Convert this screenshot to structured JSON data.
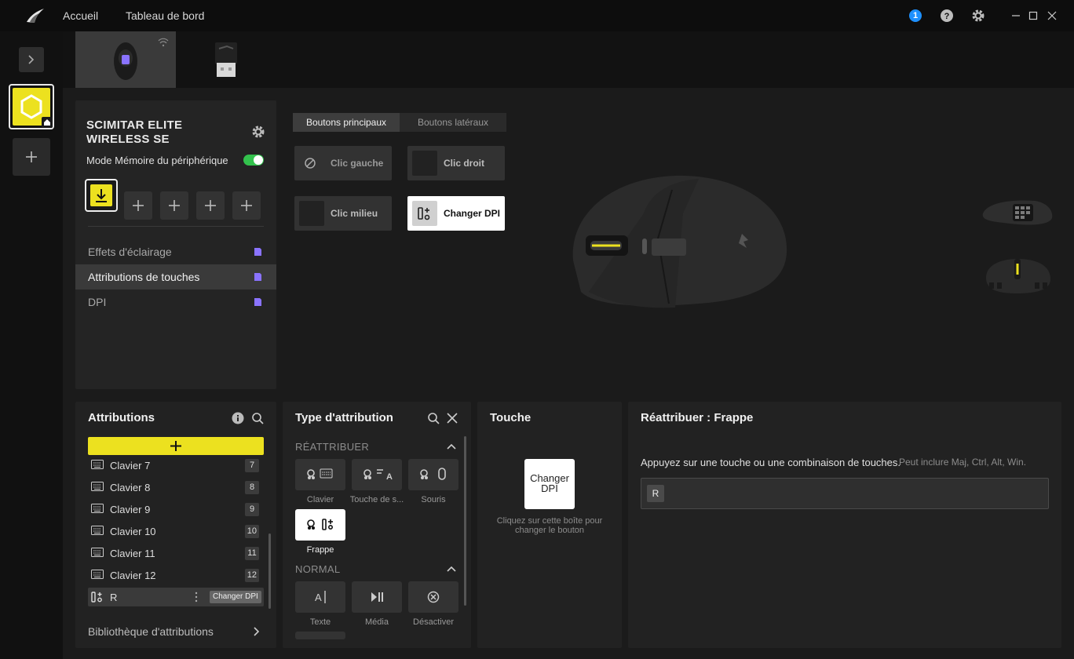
{
  "titlebar": {
    "nav_home": "Accueil",
    "nav_dashboard": "Tableau de bord",
    "notification_count": "1",
    "icons": [
      "corsair-logo-icon",
      "help-icon",
      "settings-icon",
      "minimize-icon",
      "maximize-icon",
      "close-icon"
    ]
  },
  "device": {
    "name_line1": "SCIMITAR ELITE",
    "name_line2": "WIRELESS SE",
    "memory_mode_label": "Mode Mémoire du périphérique",
    "memory_mode_on": true
  },
  "menu": {
    "items": [
      {
        "label": "Effets d'éclairage"
      },
      {
        "label": "Attributions de touches"
      },
      {
        "label": "DPI"
      }
    ]
  },
  "button_tabs": {
    "main": "Boutons principaux",
    "side": "Boutons latéraux"
  },
  "mouse_buttons": {
    "left": "Clic gauche",
    "right": "Clic droit",
    "middle": "Clic milieu",
    "dpi": "Changer DPI"
  },
  "assignments": {
    "title": "Attributions",
    "rows": [
      {
        "label": "Clavier 7",
        "badge": "7"
      },
      {
        "label": "Clavier 8",
        "badge": "8"
      },
      {
        "label": "Clavier 9",
        "badge": "9"
      },
      {
        "label": "Clavier 10",
        "badge": "10"
      },
      {
        "label": "Clavier 11",
        "badge": "11"
      },
      {
        "label": "Clavier 12",
        "badge": "12"
      }
    ],
    "selected": {
      "label": "R",
      "tag": "Changer DPI"
    },
    "library": "Bibliothèque d'attributions"
  },
  "assign_type": {
    "title": "Type d'attribution",
    "section_remap": "RÉATTRIBUER",
    "remap_tiles": [
      "Clavier",
      "Touche de s...",
      "Souris",
      "Frappe"
    ],
    "section_normal": "NORMAL",
    "normal_tiles": [
      "Texte",
      "Média",
      "Désactiver"
    ]
  },
  "key_panel": {
    "title": "Touche",
    "box_line1": "Changer",
    "box_line2": "DPI",
    "hint_line1": "Cliquez sur cette boîte pour",
    "hint_line2": "changer le bouton"
  },
  "remap_panel": {
    "title": "Réattribuer : Frappe",
    "instruction": "Appuyez sur une touche ou une combinaison de touches.",
    "hint": "Peut inclure Maj, Ctrl, Alt, Win.",
    "key_value": "R"
  },
  "colors": {
    "accent_yellow": "#ece11f",
    "toggle_green": "#33c24d",
    "memory_purple": "#8a73ff",
    "notification_blue": "#1e90ff"
  }
}
